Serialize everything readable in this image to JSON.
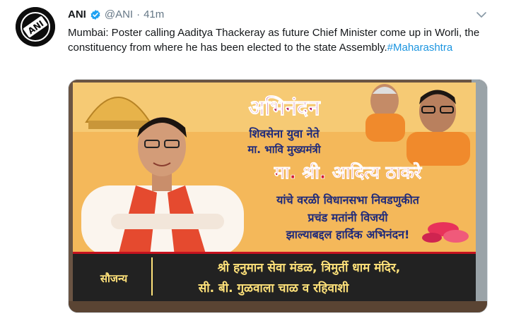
{
  "author": {
    "name": "ANI",
    "handle": "@ANI",
    "separator": "·",
    "time": "41m",
    "avatar_logo_text": "ANI"
  },
  "tweet": {
    "text": "Mumbai: Poster calling Aaditya Thackeray as future Chief Minister come up in Worli, the constituency from where he has been elected to the state Assembly.",
    "hashtag": "#Maharashtra"
  },
  "poster": {
    "header_script": "अभिनंदन",
    "line1": "शिवसेना युवा नेते",
    "line2": "मा. भावि मुख्यमंत्री",
    "name": "मा. श्री. आदित्य ठाकरे",
    "line4": "यांचे वरळी विधानसभा निवडणुकीत",
    "line5": "प्रचंड मतांनी विजयी",
    "line6": "झाल्याबद्दल हार्दिक अभिनंदन!",
    "courtesy": "सौजन्य",
    "sponsor1": "श्री हनुमान सेवा मंडळ, त्रिमुर्ती धाम मंदिर,",
    "sponsor2": "सी. बी. गुळवाला चाळ व रहिवाशी"
  },
  "colors": {
    "link": "#1b95e0",
    "verified": "#1da1f2",
    "poster_bg": "#f6c36a",
    "poster_name": "#d3162e",
    "poster_text": "#1f2a7a",
    "poster_footer": "#222222",
    "poster_footer_text": "#ffe27a"
  },
  "icons": {
    "verified": "verified-badge-icon",
    "menu": "chevron-down-icon"
  }
}
